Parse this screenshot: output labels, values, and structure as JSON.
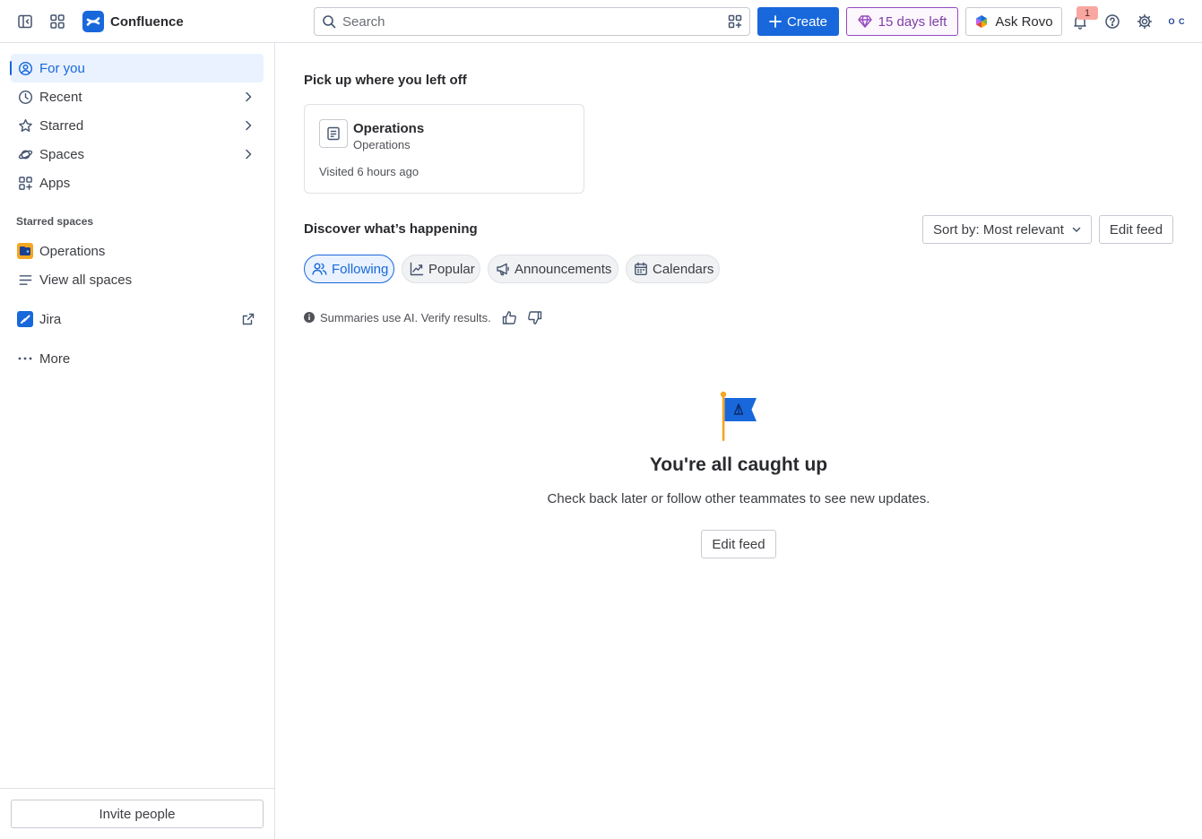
{
  "topbar": {
    "brand": "Confluence",
    "search_placeholder": "Search",
    "create_label": "Create",
    "trial_label": "15 days left",
    "rovo_label": "Ask Rovo",
    "notification_count": "1",
    "avatar_initials": "O C"
  },
  "sidebar": {
    "items": [
      {
        "label": "For you"
      },
      {
        "label": "Recent"
      },
      {
        "label": "Starred"
      },
      {
        "label": "Spaces"
      },
      {
        "label": "Apps"
      }
    ],
    "starred_spaces_label": "Starred spaces",
    "starred_spaces": [
      {
        "label": "Operations"
      }
    ],
    "view_all_spaces": "View all spaces",
    "jira_label": "Jira",
    "more_label": "More",
    "invite_label": "Invite people"
  },
  "main": {
    "pickup_heading": "Pick up where you left off",
    "recent_card": {
      "title": "Operations",
      "subtitle": "Operations",
      "meta": "Visited 6 hours ago"
    },
    "discover_heading": "Discover what’s happening",
    "sort_label": "Sort by: Most relevant",
    "edit_feed_label": "Edit feed",
    "tabs": [
      {
        "label": "Following"
      },
      {
        "label": "Popular"
      },
      {
        "label": "Announcements"
      },
      {
        "label": "Calendars"
      }
    ],
    "ai_note": "Summaries use AI. Verify results.",
    "empty_title": "You're all caught up",
    "empty_subtitle": "Check back later or follow other teammates to see new updates.",
    "empty_button": "Edit feed"
  },
  "colors": {
    "accent": "#1868db",
    "active_bg": "#e9f2fe",
    "trial": "#803fa5",
    "badge": "#f8a7a0"
  }
}
